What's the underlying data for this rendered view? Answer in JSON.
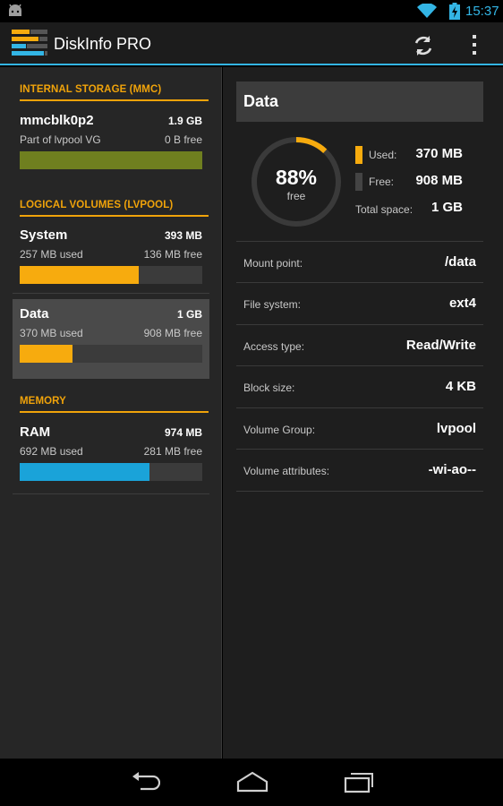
{
  "status_bar": {
    "time": "15:37",
    "icons": [
      "android-icon",
      "wifi-icon",
      "battery-charging-icon"
    ]
  },
  "action_bar": {
    "app_title": "DiskInfo PRO",
    "actions": [
      "refresh-icon",
      "overflow-menu-icon"
    ],
    "accent_color": "#33b5e5"
  },
  "sections": {
    "internal": {
      "header": "INTERNAL STORAGE (MMC)",
      "item": {
        "name": "mmcblk0p2",
        "size": "1.9 GB",
        "left": "Part of lvpool VG",
        "right": "0 B free",
        "usage_fraction": 1.0,
        "color": "#6f7f1f"
      }
    },
    "logical": {
      "header": "LOGICAL VOLUMES (LVPOOL)",
      "items": [
        {
          "name": "System",
          "size": "393 MB",
          "left": "257 MB used",
          "right": "136 MB free",
          "usage_fraction": 0.654,
          "color": "#f7ab0e"
        },
        {
          "name": "Data",
          "size": "1 GB",
          "left": "370 MB used",
          "right": "908 MB free",
          "usage_fraction": 0.29,
          "color": "#f7ab0e"
        }
      ]
    },
    "memory": {
      "header": "MEMORY",
      "item": {
        "name": "RAM",
        "size": "974 MB",
        "left": "692 MB used",
        "right": "281 MB free",
        "usage_fraction": 0.71,
        "color": "#1aa3d9"
      }
    }
  },
  "detail": {
    "title": "Data",
    "percent": "88%",
    "percent_label": "free",
    "free_fraction": 0.88,
    "used_fraction": 0.12,
    "used_label": "Used:",
    "used_value": "370 MB",
    "used_color": "#f7ab0e",
    "free_label": "Free:",
    "free_value": "908 MB",
    "total_label": "Total space:",
    "total_value": "1 GB",
    "properties": [
      {
        "label": "Mount point:",
        "value": "/data"
      },
      {
        "label": "File system:",
        "value": "ext4"
      },
      {
        "label": "Access type:",
        "value": "Read/Write"
      },
      {
        "label": "Block size:",
        "value": "4 KB"
      },
      {
        "label": "Volume Group:",
        "value": "lvpool"
      },
      {
        "label": "Volume attributes:",
        "value": "-wi-ao--"
      }
    ]
  },
  "nav_bar": {
    "buttons": [
      "back-icon",
      "home-icon",
      "recent-apps-icon"
    ]
  }
}
